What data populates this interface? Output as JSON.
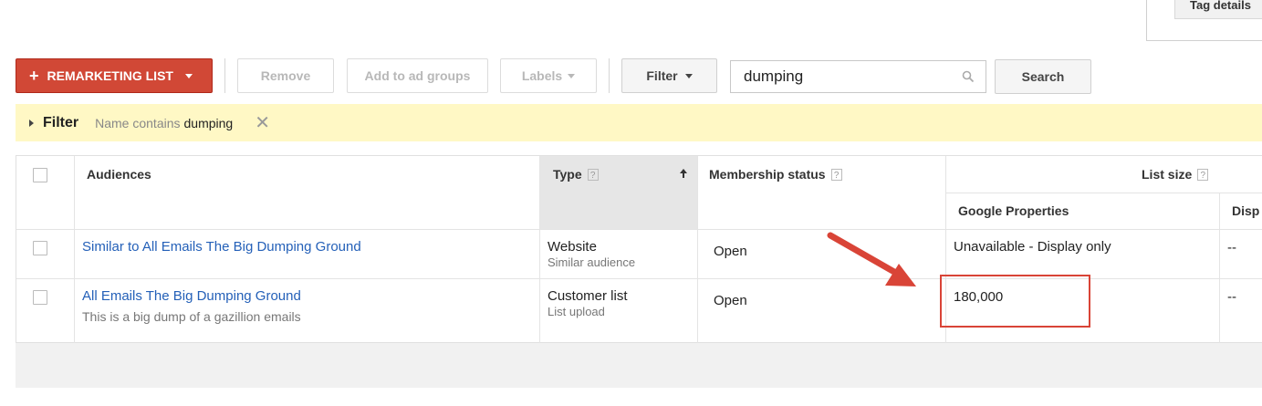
{
  "tag_panel": {
    "label": "Tag details"
  },
  "toolbar": {
    "remarketing_label": "REMARKETING LIST",
    "remove_label": "Remove",
    "add_to_ad_groups_label": "Add to ad groups",
    "labels_label": "Labels",
    "filter_label": "Filter",
    "search_value": "dumping",
    "search_label": "Search"
  },
  "filter_bar": {
    "label": "Filter",
    "description": "Name contains",
    "term": "dumping"
  },
  "table": {
    "headers": {
      "audiences": "Audiences",
      "type": "Type",
      "membership_status": "Membership status",
      "list_size": "List size",
      "google_properties": "Google Properties",
      "display": "Disp"
    },
    "help_mark": "?",
    "rows": [
      {
        "name": "Similar to All Emails The Big Dumping Ground",
        "description": "",
        "type": "Website",
        "subtype": "Similar audience",
        "membership_status": "Open",
        "google_properties": "Unavailable - Display only",
        "display": "--"
      },
      {
        "name": "All Emails The Big Dumping Ground",
        "description": "This is a big dump of a gazillion emails",
        "type": "Customer list",
        "subtype": "List upload",
        "membership_status": "Open",
        "google_properties": "180,000",
        "display": "--"
      }
    ]
  },
  "colors": {
    "primary_button": "#d14836",
    "link": "#2460b8",
    "filter_bar_bg": "#fff8c5",
    "annotation": "#d94437"
  },
  "icons": {
    "plus": "plus-icon",
    "search": "magnifier-icon",
    "clear": "close-icon",
    "sort": "arrow-up-icon",
    "expand": "triangle-right-icon"
  }
}
